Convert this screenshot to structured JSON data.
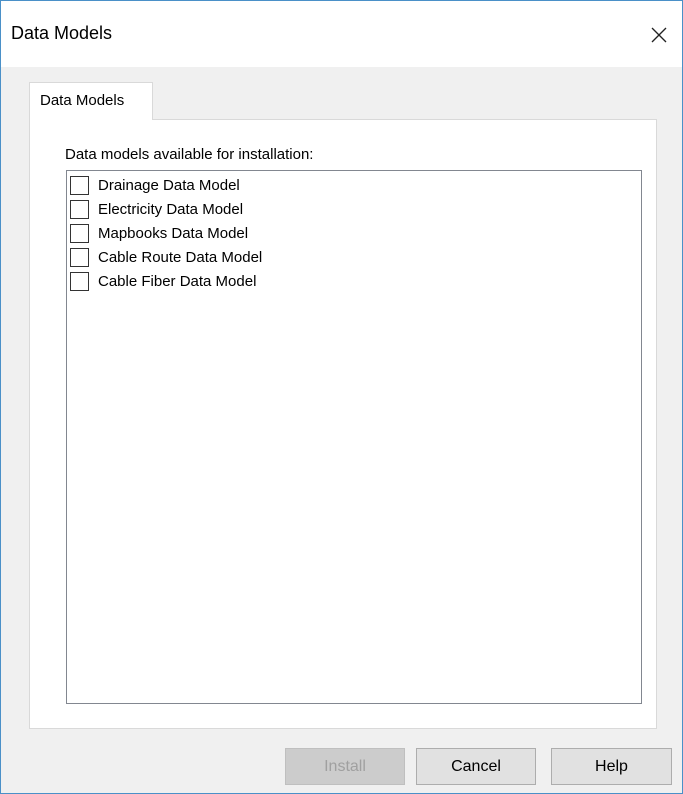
{
  "window": {
    "title": "Data Models",
    "accent_color": "#4a90c8"
  },
  "tabs": [
    {
      "label": "Data Models",
      "selected": true
    }
  ],
  "panel": {
    "group_label": "Data models available for installation:",
    "items": [
      {
        "label": "Drainage Data Model",
        "checked": false
      },
      {
        "label": "Electricity Data Model",
        "checked": false
      },
      {
        "label": "Mapbooks Data Model",
        "checked": false
      },
      {
        "label": "Cable Route Data Model",
        "checked": false
      },
      {
        "label": "Cable Fiber Data Model",
        "checked": false
      }
    ]
  },
  "buttons": {
    "install": {
      "label": "Install",
      "enabled": false
    },
    "cancel": {
      "label": "Cancel",
      "enabled": true
    },
    "help": {
      "label": "Help",
      "enabled": true
    }
  },
  "icons": {
    "close": "close-icon"
  }
}
